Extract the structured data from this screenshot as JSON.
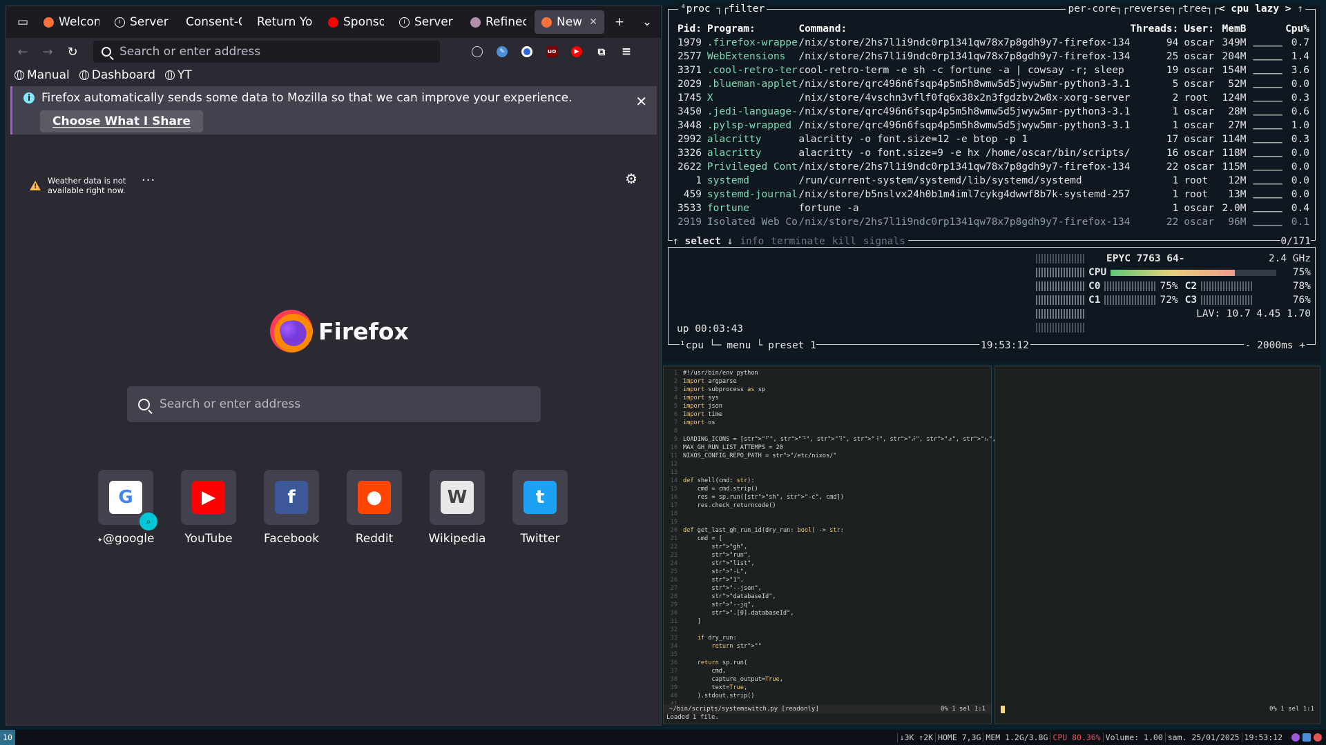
{
  "firefox": {
    "tabs": [
      {
        "label": "Welcom",
        "icon": "firefox-icon",
        "color": "#ff7139"
      },
      {
        "label": "Server",
        "icon": "info-icon",
        "color": "#fbfbfe"
      },
      {
        "label": "Consent-C",
        "icon": "",
        "color": ""
      },
      {
        "label": "Return Yo",
        "icon": "",
        "color": ""
      },
      {
        "label": "Sponso",
        "icon": "youtube-icon",
        "color": "#ff0000"
      },
      {
        "label": "Server",
        "icon": "info-icon",
        "color": "#fbfbfe"
      },
      {
        "label": "Refined",
        "icon": "github-icon",
        "color": "#b48ead"
      },
      {
        "label": "New T",
        "icon": "firefox-icon",
        "color": "#ff7139",
        "active": true
      }
    ],
    "url_placeholder": "Search or enter address",
    "bookmarks": [
      "Manual",
      "Dashboard",
      "YT"
    ],
    "notice": {
      "text": "Firefox automatically sends some data to Mozilla so that we can improve your experience.",
      "button": "Choose What I Share"
    },
    "weather": "Weather data is not available right now.",
    "brand": "Firefox",
    "newtab_placeholder": "Search or enter address",
    "shortcuts": [
      {
        "label": "@google",
        "letter": "G",
        "bg": "#ffffff",
        "fg": "#4285f4",
        "pinned": true
      },
      {
        "label": "YouTube",
        "letter": "▶",
        "bg": "#ff0000",
        "fg": "#ffffff"
      },
      {
        "label": "Facebook",
        "letter": "f",
        "bg": "#3b5998",
        "fg": "#ffffff"
      },
      {
        "label": "Reddit",
        "letter": "●",
        "bg": "#ff4500",
        "fg": "#ffffff"
      },
      {
        "label": "Wikipedia",
        "letter": "W",
        "bg": "#e8e8e8",
        "fg": "#444444"
      },
      {
        "label": "Twitter",
        "letter": "t",
        "bg": "#1da1f2",
        "fg": "#ffffff"
      }
    ]
  },
  "btop": {
    "proc_title": "proc",
    "filter": "filter",
    "toggles": [
      "per-core",
      "reverse",
      "tree",
      "< cpu lazy >"
    ],
    "headers": {
      "pid": "Pid:",
      "program": "Program:",
      "command": "Command:",
      "threads": "Threads:",
      "user": "User:",
      "mem": "MemB",
      "cpu": "Cpu%"
    },
    "processes": [
      {
        "pid": "1979",
        "program": ".firefox-wrappe",
        "command": "/nix/store/2hs7l1i9ndc0rp1341qw78x7p8gdh9y7-firefox-134",
        "threads": "94",
        "user": "oscar",
        "mem": "349M",
        "cpu": "0.7"
      },
      {
        "pid": "2577",
        "program": "WebExtensions",
        "command": "/nix/store/2hs7l1i9ndc0rp1341qw78x7p8gdh9y7-firefox-134",
        "threads": "25",
        "user": "oscar",
        "mem": "204M",
        "cpu": "1.4"
      },
      {
        "pid": "3371",
        "program": ".cool-retro-ter",
        "command": "cool-retro-term -e sh -c fortune -a | cowsay -r; sleep",
        "threads": "19",
        "user": "oscar",
        "mem": "154M",
        "cpu": "3.6"
      },
      {
        "pid": "2029",
        "program": ".blueman-applet",
        "command": "/nix/store/qrc496n6fsqp4p5m5h8wmw5d5jwyw5mr-python3-3.1",
        "threads": "5",
        "user": "oscar",
        "mem": "52M",
        "cpu": "0.0"
      },
      {
        "pid": "1745",
        "program": "X",
        "command": "/nix/store/4vschn3vflf0fq6x38x2n3fgdzbv2w8x-xorg-server",
        "threads": "2",
        "user": "root",
        "mem": "124M",
        "cpu": "0.3"
      },
      {
        "pid": "3450",
        "program": ".jedi-language-",
        "command": "/nix/store/qrc496n6fsqp4p5m5h8wmw5d5jwyw5mr-python3-3.1",
        "threads": "1",
        "user": "oscar",
        "mem": "28M",
        "cpu": "0.6"
      },
      {
        "pid": "3448",
        "program": ".pylsp-wrapped",
        "command": "/nix/store/qrc496n6fsqp4p5m5h8wmw5d5jwyw5mr-python3-3.1",
        "threads": "1",
        "user": "oscar",
        "mem": "27M",
        "cpu": "1.0"
      },
      {
        "pid": "2992",
        "program": "alacritty",
        "command": "alacritty -o font.size=12 -e btop -p 1",
        "threads": "17",
        "user": "oscar",
        "mem": "114M",
        "cpu": "0.3"
      },
      {
        "pid": "3326",
        "program": "alacritty",
        "command": "alacritty -o font.size=9 -e hx /home/oscar/bin/scripts/",
        "threads": "16",
        "user": "oscar",
        "mem": "118M",
        "cpu": "0.0"
      },
      {
        "pid": "2622",
        "program": "Privileged Cont",
        "command": "/nix/store/2hs7l1i9ndc0rp1341qw78x7p8gdh9y7-firefox-134",
        "threads": "22",
        "user": "oscar",
        "mem": "115M",
        "cpu": "0.0"
      },
      {
        "pid": "1",
        "program": "systemd",
        "command": "/run/current-system/systemd/lib/systemd/systemd",
        "threads": "1",
        "user": "root",
        "mem": "12M",
        "cpu": "0.0"
      },
      {
        "pid": "459",
        "program": "systemd-journal",
        "command": "/nix/store/b5nslvx24h0b1m4iml7cykg4dwwf8b7k-systemd-257",
        "threads": "1",
        "user": "root",
        "mem": "13M",
        "cpu": "0.0"
      },
      {
        "pid": "3533",
        "program": "fortune",
        "command": "fortune -a",
        "threads": "1",
        "user": "oscar",
        "mem": "2.0M",
        "cpu": "0.4"
      },
      {
        "pid": "2919",
        "program": "Isolated Web Co",
        "command": "/nix/store/2hs7l1i9ndc0rp1341qw78x7p8gdh9y7-firefox-134",
        "threads": "22",
        "user": "oscar",
        "mem": "96M",
        "cpu": "0.1"
      }
    ],
    "proc_footer": {
      "select": "select",
      "info": "info",
      "terminate": "terminate",
      "kill": "kill",
      "signals": "signals",
      "count": "0/171"
    },
    "cpu": {
      "model": "EPYC 7763 64-",
      "freq": "2.4 GHz",
      "total_label": "CPU",
      "total_pct": "75%",
      "total_fraction": 0.75,
      "cores": [
        {
          "name": "C0",
          "pct": "75%"
        },
        {
          "name": "C2",
          "pct": "78%"
        },
        {
          "name": "C1",
          "pct": "72%"
        },
        {
          "name": "C3",
          "pct": "76%"
        }
      ],
      "lav": "LAV: 10.7 4.45 1.70",
      "uptime": "up 00:03:43",
      "footer_cpu": "cpu",
      "footer_menu": "menu",
      "footer_preset": "preset 1",
      "clock": "19:53:12",
      "interval": "- 2000ms +"
    }
  },
  "editor": {
    "code": [
      "#!/usr/bin/env python",
      "import argparse",
      "import subprocess as sp",
      "import sys",
      "import json",
      "import time",
      "import os",
      "",
      "LOADING_ICONS = [\"⠋\", \"⠙\", \"⠹\", \"⠸\", \"⠼\", \"⠴\", \"⠦\", \"⠧\"]",
      "MAX_GH_RUN_LIST_ATTEMPS = 20",
      "NIXOS_CONFIG_REPO_PATH = \"/etc/nixos/\"",
      "",
      "",
      "def shell(cmd: str):",
      "    cmd = cmd.strip()",
      "    res = sp.run([\"sh\", \"-c\", cmd])",
      "    res.check_returncode()",
      "",
      "",
      "def get_last_gh_run_id(dry_run: bool) -> str:",
      "    cmd = [",
      "        \"gh\",",
      "        \"run\",",
      "        \"list\",",
      "        \"-L\",",
      "        \"1\",",
      "        \"--json\",",
      "        \"databaseId\",",
      "        \"--jq\",",
      "        \".[0].databaseId\",",
      "    ]",
      "",
      "    if dry_run:",
      "        return \"\"",
      "",
      "    return sp.run(",
      "        cmd,",
      "        capture_output=True,",
      "        text=True,",
      "    ).stdout.strip()",
      ""
    ],
    "left_status": "~/bin/scripts/systemswitch.py  [readonly]",
    "left_status_right": "0%   1 sel  1:1",
    "message": "Loaded 1 file.",
    "right_status_right": "0%   1 sel  1:1"
  },
  "statusbar": {
    "workspace": "10",
    "items": [
      "↓3K ↑2K",
      "HOME 7,3G",
      "MEM 1.2G/3.8G",
      "CPU 80.36%",
      "Volume: 1.00",
      "sam. 25/01/2025",
      "19:53:12"
    ],
    "hot_index": 3
  }
}
